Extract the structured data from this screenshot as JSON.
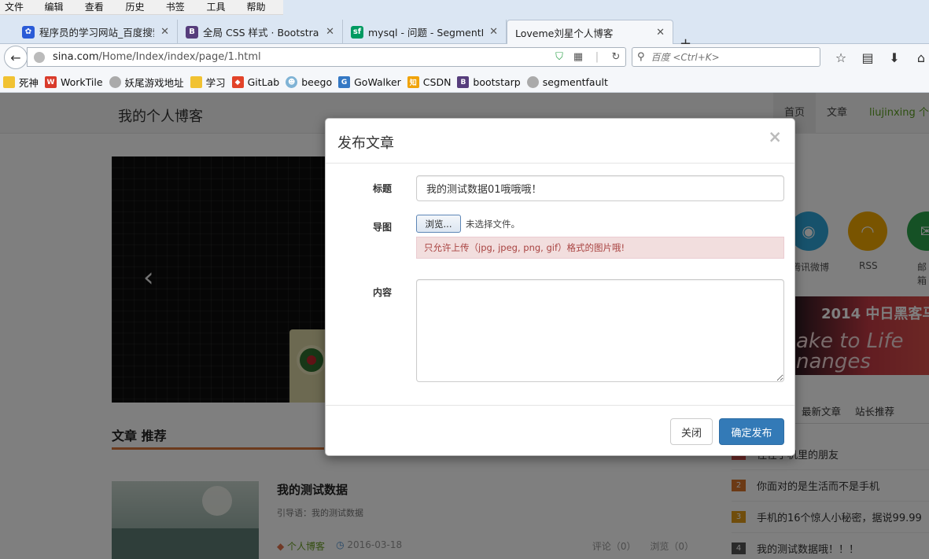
{
  "browser": {
    "menu": [
      "文件(F)",
      "编辑(E)",
      "查看(V)",
      "历史(S)",
      "书签(B)",
      "工具(T)",
      "帮助(H)"
    ],
    "tabs": [
      {
        "title": "程序员的学习网站_百度搜索",
        "icon": "baidu-paw-icon"
      },
      {
        "title": "全局 CSS 样式 · Bootstra...",
        "icon": "bootstrap-b-icon"
      },
      {
        "title": "mysql - 问题 - SegmentF...",
        "icon": "segmentfault-sf-icon"
      },
      {
        "title": "Loveme刘星个人博客",
        "icon": ""
      }
    ],
    "new_tab": "+",
    "url_domain": "sina.com",
    "url_path": "/Home/Index/index/page/1.html",
    "search_placeholder": "百度 <Ctrl+K>",
    "bookmarks": [
      "死神",
      "WorkTile",
      "妖尾游戏地址",
      "学习",
      "GitLab",
      "beego",
      "GoWalker",
      "CSDN",
      "bootstarp",
      "segmentfault"
    ]
  },
  "site": {
    "title": "我的个人博客",
    "nav": [
      "首页",
      "文章",
      "liujinxing 个人"
    ],
    "section_title": "文章 推荐",
    "post": {
      "title": "我的测试数据",
      "intro": "引导语：我的测试数据",
      "tag": "个人博客",
      "date": "2016-03-18",
      "comments": "评论（0）",
      "views": "浏览（0）"
    },
    "share": [
      {
        "label": "腾讯微博",
        "color": "#2fa5d8"
      },
      {
        "label": "RSS",
        "color": "#f2a900"
      },
      {
        "label": "邮箱",
        "color": "#2aa34a"
      }
    ],
    "banner": {
      "line1": "2014 中日黑客马",
      "line2": "ake  to Life",
      "line3": "nanges"
    },
    "side_tabs": [
      "最新文章",
      "站长推荐"
    ],
    "hot": [
      {
        "num": "",
        "title": "住在手机里的朋友",
        "color": "#d9534f"
      },
      {
        "num": "2",
        "title": "你面对的是生活而不是手机",
        "color": "#d9742b"
      },
      {
        "num": "3",
        "title": "手机的16个惊人小秘密，据说99.99",
        "color": "#e09a18"
      },
      {
        "num": "4",
        "title": "我的测试数据哦！！！",
        "color": "#555555"
      }
    ]
  },
  "modal": {
    "title": "发布文章",
    "close_symbol": "×",
    "label_title": "标题",
    "title_value": "我的测试数据01哦哦哦！",
    "label_image": "导图",
    "file_button": "浏览...",
    "file_status": "未选择文件。",
    "file_hint": "只允许上传（jpg, jpeg, png, gif）格式的图片哦!",
    "label_content": "内容",
    "content_value": "",
    "btn_close": "关闭",
    "btn_submit": "确定发布"
  }
}
